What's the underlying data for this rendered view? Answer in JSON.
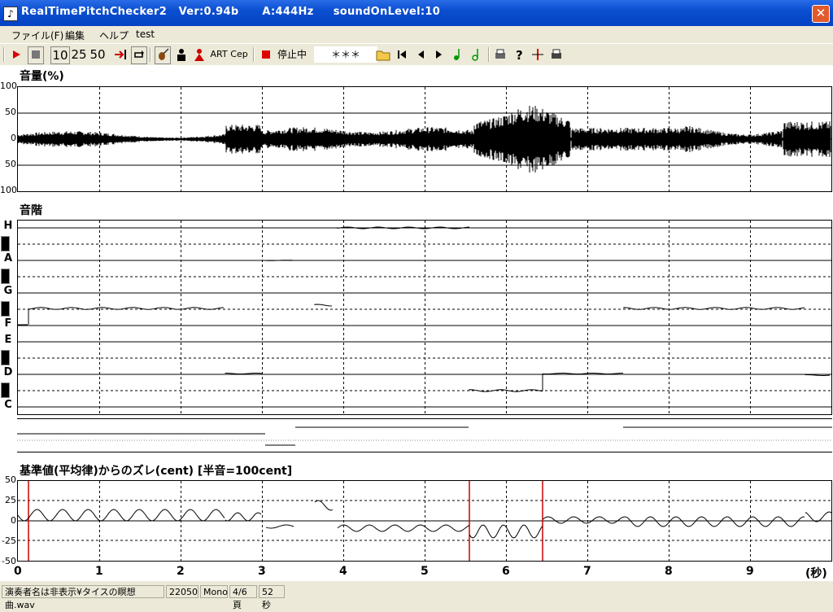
{
  "window": {
    "title": "RealTimePitchChecker2   Ver:0.94b      A:444Hz     soundOnLevel:10",
    "close": "✕"
  },
  "menu": [
    "ファイル(F)",
    "編集",
    "ヘルプ",
    "test"
  ],
  "toolbar": {
    "counts": [
      "10",
      "25",
      "50"
    ],
    "art": "ART",
    "cep": "Cep",
    "state": "停止中",
    "note": "＊＊＊"
  },
  "panels": {
    "volume": {
      "title": "音量(%)",
      "yticks": [
        "100",
        "50",
        "0",
        "50",
        "100"
      ]
    },
    "scale": {
      "title": "音階",
      "notes": [
        "H",
        "A",
        "G",
        "F",
        "E",
        "D",
        "C"
      ]
    },
    "deviation": {
      "title": "基準値(平均律)からのズレ(cent) [半音=100cent]",
      "yticks": [
        "50",
        "25",
        "0",
        "-25",
        "-50"
      ]
    }
  },
  "xaxis": {
    "ticks": [
      "0",
      "1",
      "2",
      "3",
      "4",
      "5",
      "6",
      "7",
      "8",
      "9"
    ],
    "unit": "(秒)"
  },
  "status": {
    "file": "演奏者名は非表示¥タイスの瞑想曲.wav",
    "rate": "22050",
    "channels": "Mono",
    "page": "4/6頁",
    "duration": "52秒"
  },
  "colors": {
    "titlebar": "#0a4fd0",
    "marker": "#cc0000",
    "trace": "#000000"
  }
}
